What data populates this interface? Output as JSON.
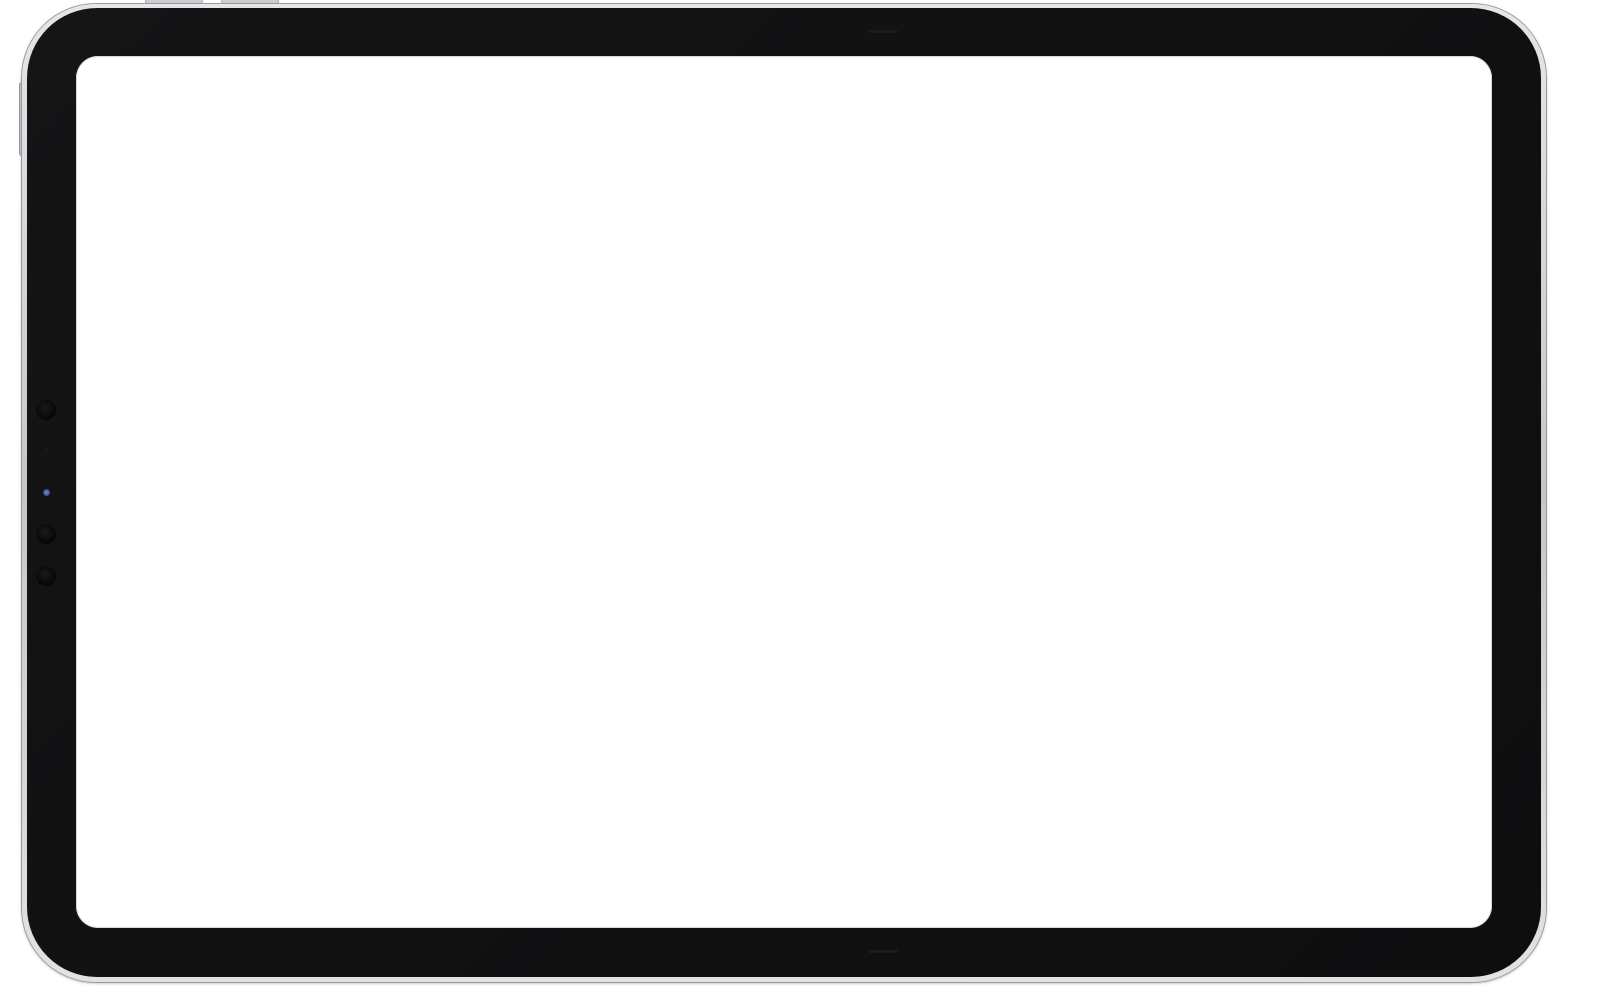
{
  "device": {
    "type": "tablet",
    "orientation": "landscape",
    "screen_content": "",
    "colors": {
      "frame": "#c6c6ca",
      "bezel": "#111112",
      "screen": "#ffffff",
      "camera_lens": "#3c4f95"
    },
    "icons": [
      "front-camera-icon",
      "sensor-icon"
    ]
  }
}
